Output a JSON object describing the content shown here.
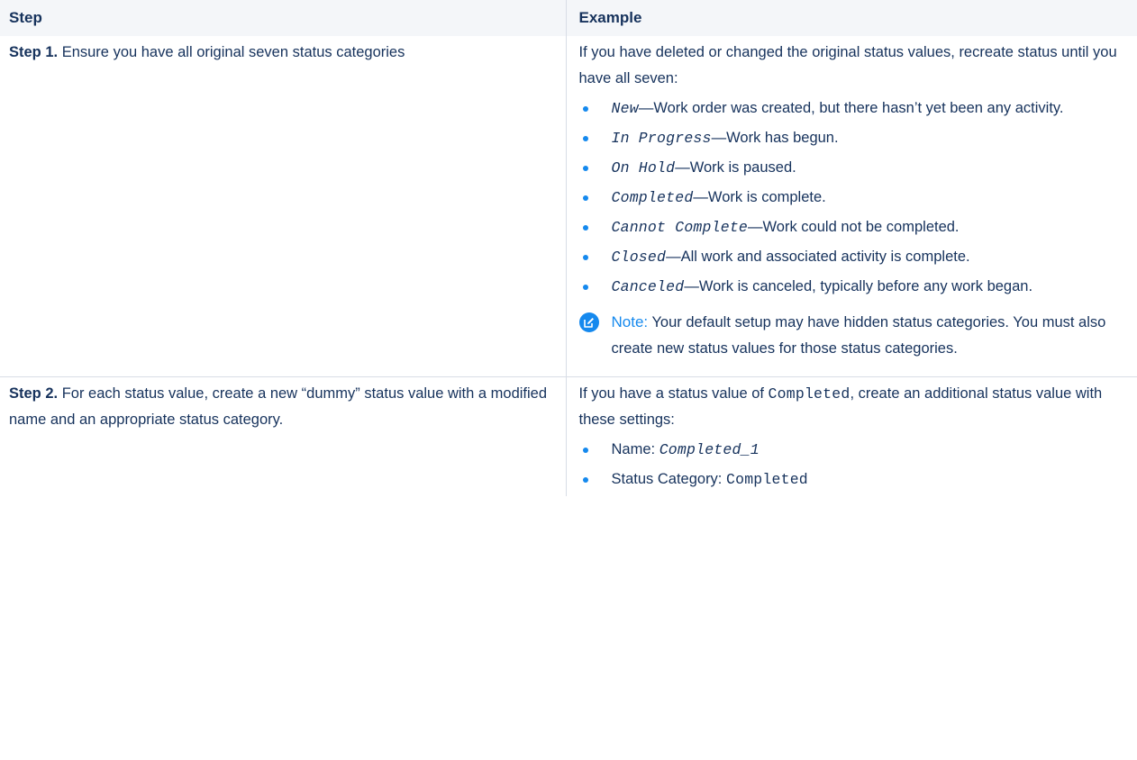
{
  "table": {
    "headers": {
      "step": "Step",
      "example": "Example"
    },
    "rows": [
      {
        "step_number": "Step 1.",
        "step_text": "Ensure you have all original seven status categories",
        "example_intro": "If you have deleted or changed the original status values, recreate status until you have all seven:",
        "bullets": [
          {
            "code": "New",
            "text": "—Work order was created, but there hasn’t yet been any activity."
          },
          {
            "code": "In Progress",
            "text": "—Work has begun."
          },
          {
            "code": "On Hold",
            "text": "—Work is paused."
          },
          {
            "code": "Completed",
            "text": "—Work is complete."
          },
          {
            "code": "Cannot Complete",
            "text": "—Work could not be completed."
          },
          {
            "code": "Closed",
            "text": "—All work and associated activity is complete."
          },
          {
            "code": "Canceled",
            "text": "—Work is canceled, typically before any work began."
          }
        ],
        "note": {
          "label": "Note:",
          "text": "Your default setup may have hidden status categories. You must also create new status values for those status categories."
        }
      },
      {
        "step_number": "Step 2.",
        "step_text": "For each status value, create a new “dummy” status value with a modified name and an appropriate status category.",
        "example_intro_before": "If you have a status value of ",
        "example_intro_code": "Completed",
        "example_intro_after": ", create an additional status value with these settings:",
        "settings": [
          {
            "label": "Name: ",
            "code": "Completed_1",
            "italic": true
          },
          {
            "label": "Status Category: ",
            "code": "Completed",
            "italic": false
          }
        ]
      }
    ]
  },
  "colors": {
    "text": "#16325c",
    "accent": "#1589ee",
    "header_bg": "#f4f6f9",
    "divider": "#d8dde6"
  },
  "icons": {
    "note": "edit-note-icon",
    "bullet": "bullet-dot-icon"
  }
}
